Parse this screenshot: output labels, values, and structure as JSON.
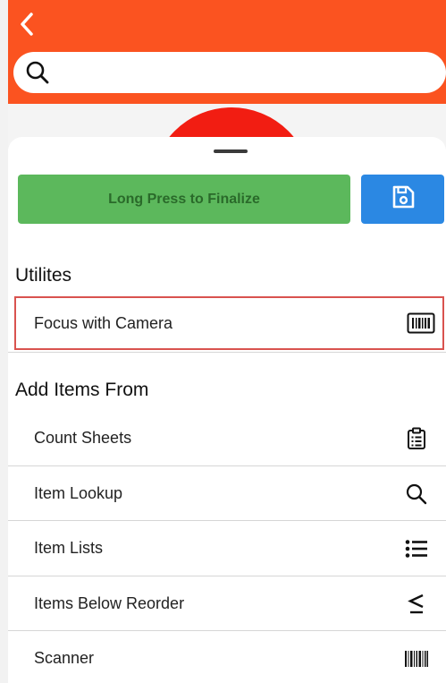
{
  "search": {
    "placeholder": "",
    "value": ""
  },
  "actions": {
    "finalize_label": "Long Press to Finalize"
  },
  "utilities": {
    "title": "Utilites",
    "items": [
      {
        "label": "Focus with Camera",
        "icon": "barcode-box-icon"
      }
    ]
  },
  "add_items": {
    "title": "Add Items From",
    "items": [
      {
        "label": "Count Sheets",
        "icon": "clipboard-list-icon"
      },
      {
        "label": "Item Lookup",
        "icon": "search-icon"
      },
      {
        "label": "Item Lists",
        "icon": "list-icon"
      },
      {
        "label": "Items Below Reorder",
        "icon": "less-than-equal-icon"
      },
      {
        "label": "Scanner",
        "icon": "barcode-icon"
      }
    ]
  },
  "colors": {
    "header": "#fb5320",
    "finalize_button": "#5cb85c",
    "save_button": "#2b88e3",
    "highlight_border": "#d9534f"
  }
}
